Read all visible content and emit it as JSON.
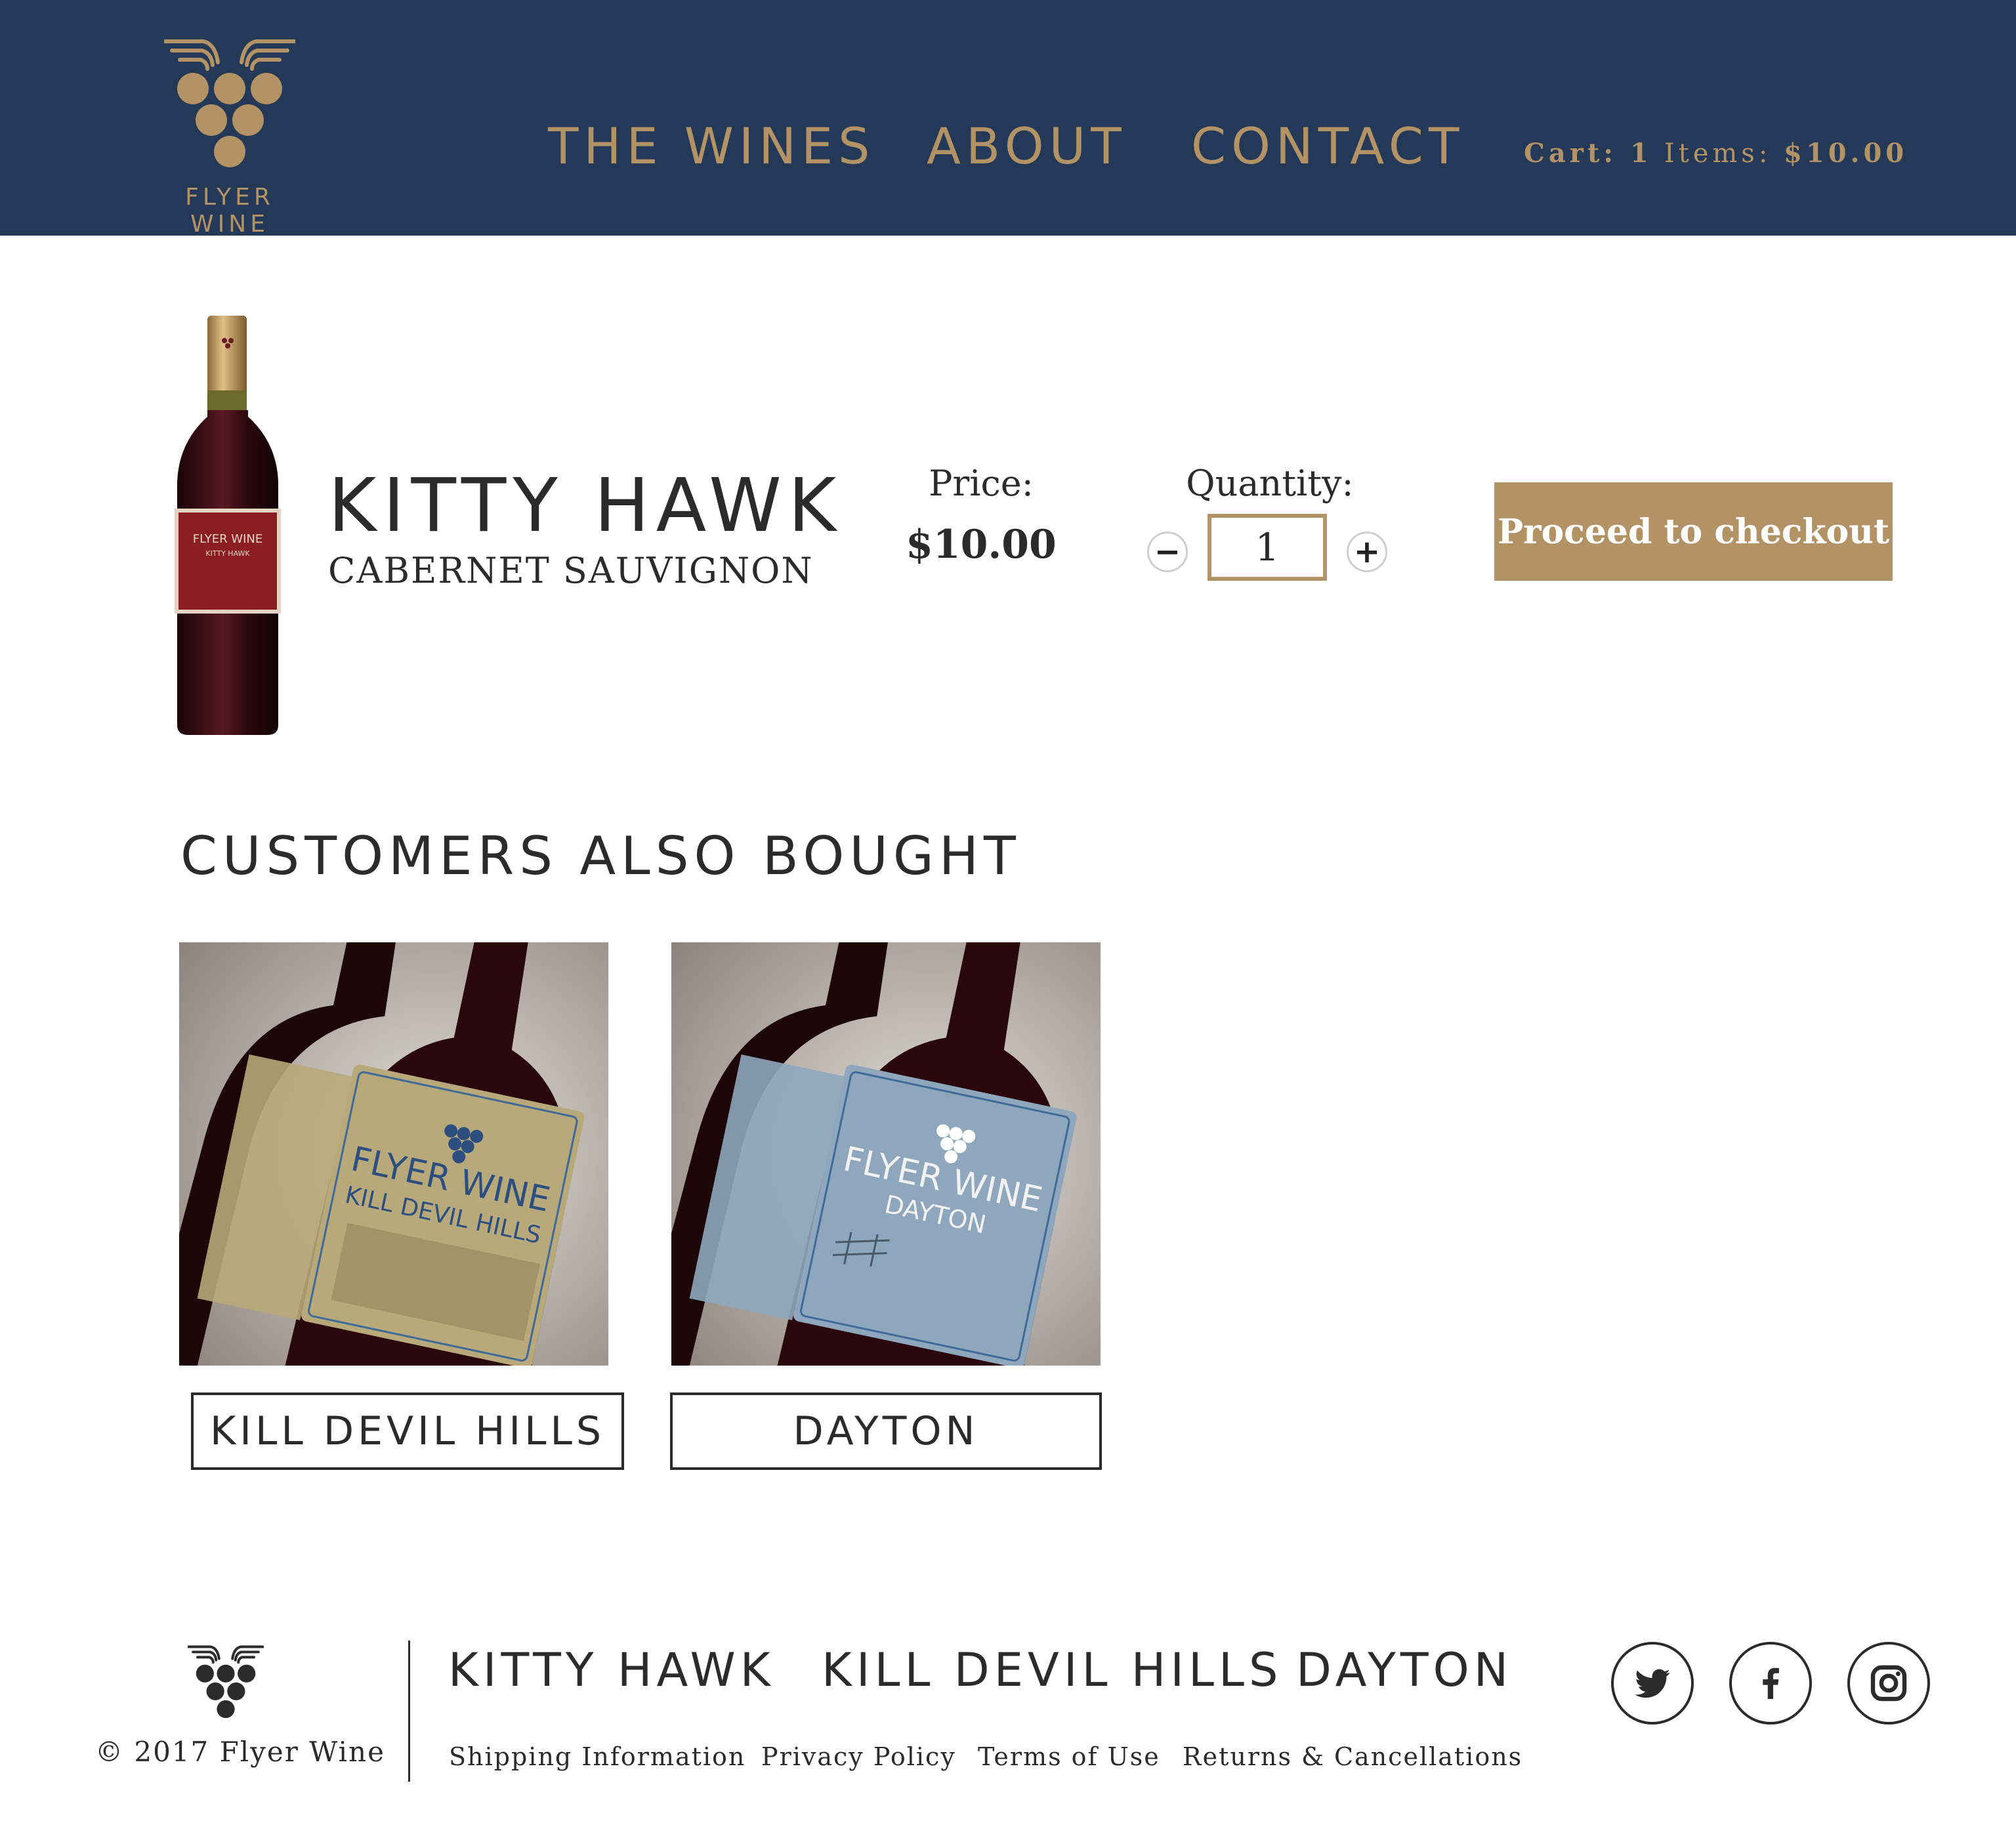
{
  "header": {
    "logo_text": "FLYER WINE",
    "nav": [
      "THE WINES",
      "ABOUT",
      "CONTACT"
    ],
    "cart_label": "Cart: 1",
    "items_label": "Items:",
    "items_total": "$10.00"
  },
  "product": {
    "name": "KITTY HAWK",
    "varietal": "CABERNET SAUVIGNON",
    "price_label": "Price:",
    "price": "$10.00",
    "quantity_label": "Quantity:",
    "quantity": "1",
    "minus": "−",
    "plus": "+",
    "checkout_label": "Proceed to checkout",
    "bottle_label_line1": "FLYER WINE",
    "bottle_label_line2": "KITTY HAWK"
  },
  "also_bought": {
    "title": "CUSTOMERS ALSO  BOUGHT",
    "items": [
      {
        "name": "KILL DEVIL HILLS",
        "label_line1": "FLYER WINE",
        "label_line2": "KILL DEVIL HILLS",
        "label_color": "#b8a97a"
      },
      {
        "name": "DAYTON",
        "label_line1": "FLYER WINE",
        "label_line2": "DAYTON",
        "label_color": "#8fa7bd"
      }
    ]
  },
  "footer": {
    "copyright": "© 2017 Flyer Wine",
    "wines": [
      "KITTY HAWK",
      "KILL DEVIL HILLS",
      "DAYTON"
    ],
    "links": [
      "Shipping Information",
      "Privacy Policy",
      "Terms of Use",
      "Returns & Cancellations"
    ],
    "social": [
      "twitter-icon",
      "facebook-icon",
      "instagram-icon"
    ]
  },
  "colors": {
    "navy": "#233957",
    "gold": "#b39365",
    "text": "#2b2b2b"
  }
}
